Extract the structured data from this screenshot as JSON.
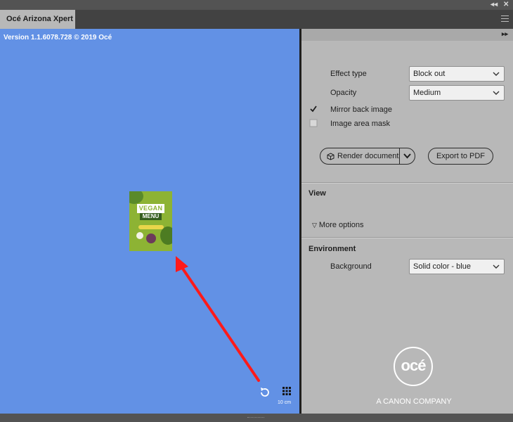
{
  "window": {
    "collapse_glyph": "◂◂",
    "close_glyph": "✕"
  },
  "tab": {
    "title": "Océ Arizona Xpert"
  },
  "canvas": {
    "version_text": "Version 1.1.6078.728 © 2019 Océ",
    "background_color": "#6291e5",
    "preview": {
      "line1": "VEGAN",
      "line2": "MENU"
    },
    "scale_text": "10 cm"
  },
  "panel": {
    "expand_glyph": "▸▸",
    "effect_type": {
      "label": "Effect type",
      "value": "Block out"
    },
    "opacity": {
      "label": "Opacity",
      "value": "Medium"
    },
    "mirror_back_image": {
      "label": "Mirror back image",
      "checked": true
    },
    "image_area_mask": {
      "label": "Image area mask",
      "checked": false
    },
    "render_button": "Render document",
    "export_button": "Export to PDF",
    "view": {
      "title": "View",
      "more_options": "More options"
    },
    "environment": {
      "title": "Environment",
      "background": {
        "label": "Background",
        "value": "Solid color - blue"
      }
    },
    "logo_text": "océ",
    "company_text": "A CANON COMPANY"
  }
}
